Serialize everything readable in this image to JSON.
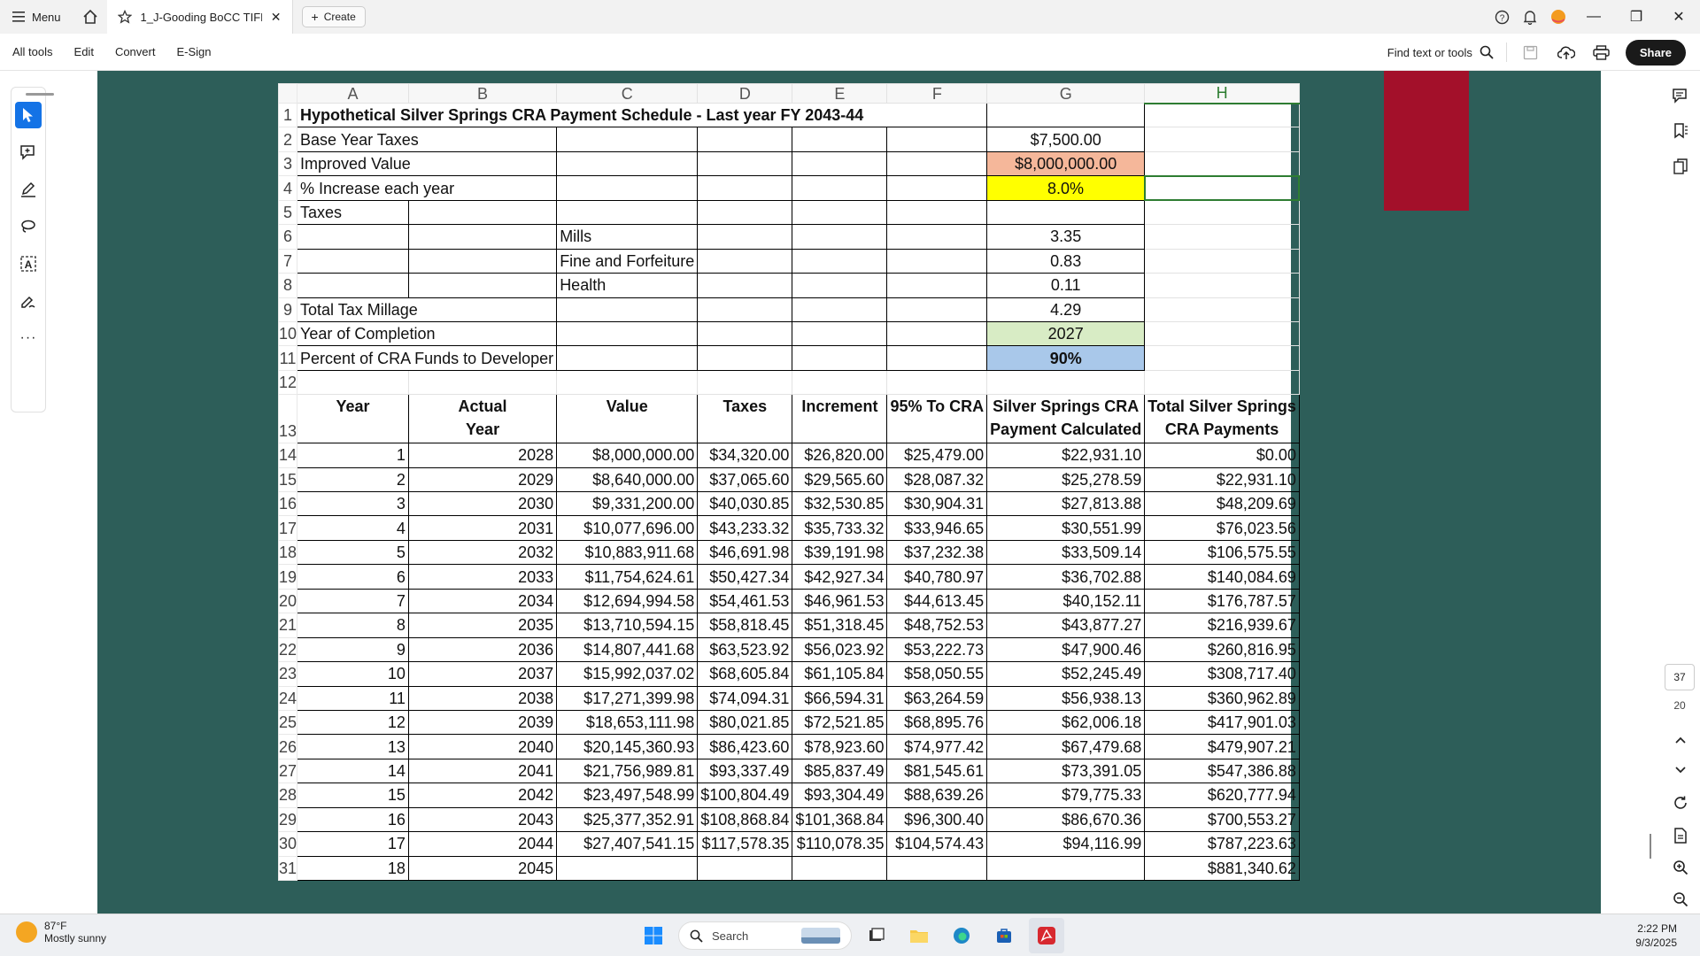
{
  "titlebar": {
    "menu_label": "Menu",
    "tab_title": "1_J-Gooding BoCC TIFF ...",
    "create_label": "Create"
  },
  "toolbar": {
    "items": [
      "All tools",
      "Edit",
      "Convert",
      "E-Sign"
    ],
    "find_label": "Find text or tools",
    "share_label": "Share"
  },
  "page_nav": {
    "current": "37",
    "total": "20"
  },
  "sheet": {
    "columns": [
      "A",
      "B",
      "C",
      "D",
      "E",
      "F",
      "G",
      "H"
    ],
    "title": "Hypothetical Silver Springs CRA Payment Schedule - Last year FY 2043-44",
    "params": [
      {
        "row": "2",
        "label": "Base Year Taxes",
        "value": "$7,500.00"
      },
      {
        "row": "3",
        "label": "Improved Value",
        "value": "$8,000,000.00"
      },
      {
        "row": "4",
        "label": "% Increase each year",
        "value": "8.0%"
      },
      {
        "row": "5",
        "label": "Taxes",
        "value": ""
      },
      {
        "row": "6",
        "label": "Mills",
        "value": "3.35"
      },
      {
        "row": "7",
        "label": "Fine and Forfeiture",
        "value": "0.83"
      },
      {
        "row": "8",
        "label": "Health",
        "value": "0.11"
      },
      {
        "row": "9",
        "label": "Total Tax Millage",
        "value": "4.29"
      },
      {
        "row": "10",
        "label": "Year of Completion",
        "value": "2027"
      },
      {
        "row": "11",
        "label": "Percent of CRA Funds to Developer",
        "value": "90%"
      }
    ],
    "headers": {
      "year": "Year",
      "actual_year_1": "Actual",
      "actual_year_2": "Year",
      "value": "Value",
      "taxes": "Taxes",
      "increment": "Increment",
      "to_cra": "95% To CRA",
      "calc_1": "Silver Springs CRA",
      "calc_2": "Payment Calculated",
      "total_1": "Total Silver Springs",
      "total_2": "CRA Payments"
    },
    "rows": [
      [
        "1",
        "2028",
        "$8,000,000.00",
        "$34,320.00",
        "$26,820.00",
        "$25,479.00",
        "$22,931.10",
        "$0.00"
      ],
      [
        "2",
        "2029",
        "$8,640,000.00",
        "$37,065.60",
        "$29,565.60",
        "$28,087.32",
        "$25,278.59",
        "$22,931.10"
      ],
      [
        "3",
        "2030",
        "$9,331,200.00",
        "$40,030.85",
        "$32,530.85",
        "$30,904.31",
        "$27,813.88",
        "$48,209.69"
      ],
      [
        "4",
        "2031",
        "$10,077,696.00",
        "$43,233.32",
        "$35,733.32",
        "$33,946.65",
        "$30,551.99",
        "$76,023.56"
      ],
      [
        "5",
        "2032",
        "$10,883,911.68",
        "$46,691.98",
        "$39,191.98",
        "$37,232.38",
        "$33,509.14",
        "$106,575.55"
      ],
      [
        "6",
        "2033",
        "$11,754,624.61",
        "$50,427.34",
        "$42,927.34",
        "$40,780.97",
        "$36,702.88",
        "$140,084.69"
      ],
      [
        "7",
        "2034",
        "$12,694,994.58",
        "$54,461.53",
        "$46,961.53",
        "$44,613.45",
        "$40,152.11",
        "$176,787.57"
      ],
      [
        "8",
        "2035",
        "$13,710,594.15",
        "$58,818.45",
        "$51,318.45",
        "$48,752.53",
        "$43,877.27",
        "$216,939.67"
      ],
      [
        "9",
        "2036",
        "$14,807,441.68",
        "$63,523.92",
        "$56,023.92",
        "$53,222.73",
        "$47,900.46",
        "$260,816.95"
      ],
      [
        "10",
        "2037",
        "$15,992,037.02",
        "$68,605.84",
        "$61,105.84",
        "$58,050.55",
        "$52,245.49",
        "$308,717.40"
      ],
      [
        "11",
        "2038",
        "$17,271,399.98",
        "$74,094.31",
        "$66,594.31",
        "$63,264.59",
        "$56,938.13",
        "$360,962.89"
      ],
      [
        "12",
        "2039",
        "$18,653,111.98",
        "$80,021.85",
        "$72,521.85",
        "$68,895.76",
        "$62,006.18",
        "$417,901.03"
      ],
      [
        "13",
        "2040",
        "$20,145,360.93",
        "$86,423.60",
        "$78,923.60",
        "$74,977.42",
        "$67,479.68",
        "$479,907.21"
      ],
      [
        "14",
        "2041",
        "$21,756,989.81",
        "$93,337.49",
        "$85,837.49",
        "$81,545.61",
        "$73,391.05",
        "$547,386.88"
      ],
      [
        "15",
        "2042",
        "$23,497,548.99",
        "$100,804.49",
        "$93,304.49",
        "$88,639.26",
        "$79,775.33",
        "$620,777.94"
      ],
      [
        "16",
        "2043",
        "$25,377,352.91",
        "$108,868.84",
        "$101,368.84",
        "$96,300.40",
        "$86,670.36",
        "$700,553.27"
      ],
      [
        "17",
        "2044",
        "$27,407,541.15",
        "$117,578.35",
        "$110,078.35",
        "$104,574.43",
        "$94,116.99",
        "$787,223.63"
      ],
      [
        "18",
        "2045",
        "",
        "",
        "",
        "",
        "",
        "$881,340.62"
      ]
    ]
  },
  "taskbar": {
    "temp": "87°F",
    "condition": "Mostly sunny",
    "search_placeholder": "Search",
    "time": "2:22 PM",
    "date": "9/3/2025"
  },
  "colors": {
    "background": "#2d5e59",
    "accent": "#1473e6",
    "improved_value_fill": "#f5b79a",
    "increase_fill": "#ffff00",
    "completion_fill": "#d8ecc5",
    "percent_fill": "#a9c8ea",
    "side_panel": "#a3102a"
  }
}
